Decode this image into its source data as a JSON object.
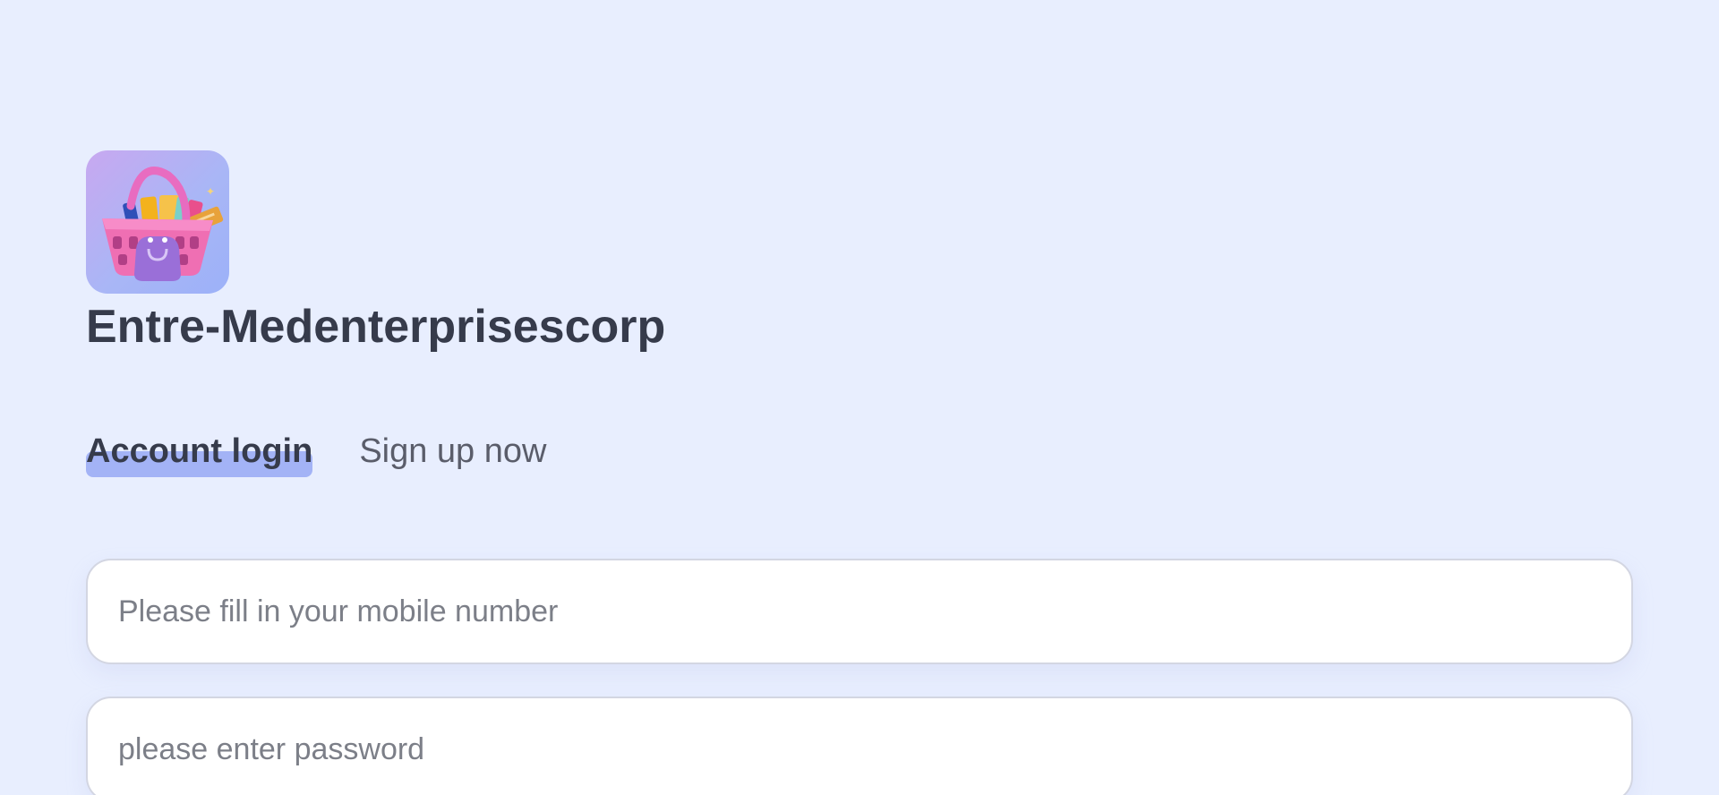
{
  "app": {
    "name": "Entre-Medenterprisescorp"
  },
  "tabs": [
    {
      "label": "Account login",
      "active": true
    },
    {
      "label": "Sign up now",
      "active": false
    }
  ],
  "form": {
    "mobile": {
      "placeholder": "Please fill in your mobile number",
      "value": ""
    },
    "password": {
      "placeholder": "please enter password",
      "value": ""
    }
  },
  "colors": {
    "background": "#e8eefe",
    "title": "#363b4b",
    "tab_underline": "#a3b3f6",
    "input_border": "#d3d6e2",
    "placeholder": "#7c7f88"
  },
  "icons": {
    "logo": "shopping-basket-icon"
  }
}
